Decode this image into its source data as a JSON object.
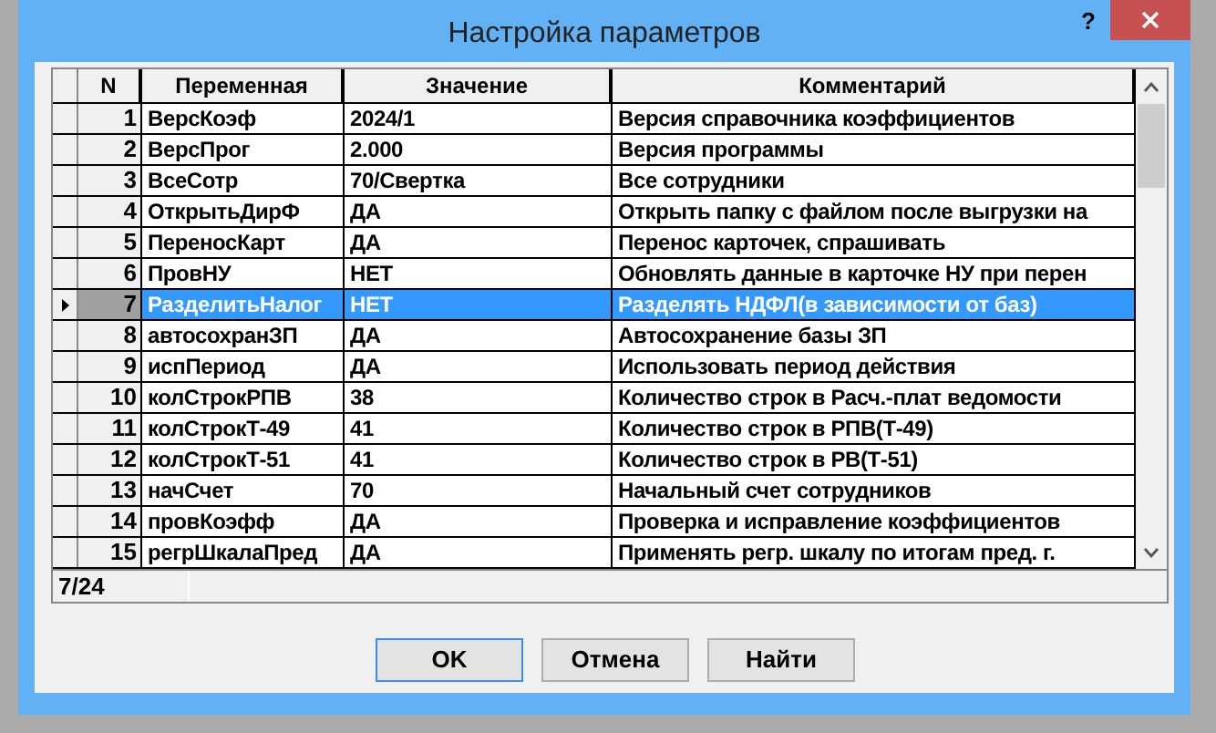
{
  "window": {
    "title": "Настройка параметров",
    "help": "?"
  },
  "table": {
    "columns": [
      "N",
      "Переменная",
      "Значение",
      "Комментарий"
    ],
    "rows": [
      {
        "n": "1",
        "name": "ВерсКоэф",
        "value": "2024/1",
        "comment": "Версия справочника коэффициентов",
        "selected": false
      },
      {
        "n": "2",
        "name": "ВерсПрог",
        "value": "2.000",
        "comment": "Версия программы",
        "selected": false
      },
      {
        "n": "3",
        "name": "ВсеСотр",
        "value": "70/Свертка",
        "comment": "Все сотрудники",
        "selected": false
      },
      {
        "n": "4",
        "name": "ОткрытьДирФ",
        "value": "ДА",
        "comment": "Открыть папку с файлом после выгрузки на",
        "selected": false
      },
      {
        "n": "5",
        "name": "ПереносКарт",
        "value": "ДА",
        "comment": "Перенос карточек, спрашивать",
        "selected": false
      },
      {
        "n": "6",
        "name": "ПровНУ",
        "value": "НЕТ",
        "comment": "Обновлять данные в карточке НУ при перен",
        "selected": false
      },
      {
        "n": "7",
        "name": "РазделитьНалог",
        "value": "НЕТ",
        "comment": "Разделять НДФЛ(в зависимости от баз)",
        "selected": true
      },
      {
        "n": "8",
        "name": "автосохранЗП",
        "value": "ДА",
        "comment": "Автосохранение базы ЗП",
        "selected": false
      },
      {
        "n": "9",
        "name": "испПериод",
        "value": "ДА",
        "comment": "Использовать период действия",
        "selected": false
      },
      {
        "n": "10",
        "name": "колСтрокРПВ",
        "value": "38",
        "comment": "Количество строк в Расч.-плат ведомости",
        "selected": false
      },
      {
        "n": "11",
        "name": "колСтрокТ-49",
        "value": "41",
        "comment": "Количество строк в РПВ(Т-49)",
        "selected": false
      },
      {
        "n": "12",
        "name": "колСтрокТ-51",
        "value": "41",
        "comment": "Количество строк в РВ(Т-51)",
        "selected": false
      },
      {
        "n": "13",
        "name": "начСчет",
        "value": "70",
        "comment": "Начальный счет сотрудников",
        "selected": false
      },
      {
        "n": "14",
        "name": "провКоэфф",
        "value": "ДА",
        "comment": "Проверка и исправление коэффициентов",
        "selected": false
      },
      {
        "n": "15",
        "name": "регрШкалаПред",
        "value": "ДА",
        "comment": "Применять регр. шкалу по итогам пред. г.",
        "selected": false
      }
    ]
  },
  "status_bar": "7/24",
  "buttons": [
    {
      "label": "OK",
      "default": true
    },
    {
      "label": "Отмена",
      "default": false
    },
    {
      "label": "Найти",
      "default": false
    }
  ]
}
